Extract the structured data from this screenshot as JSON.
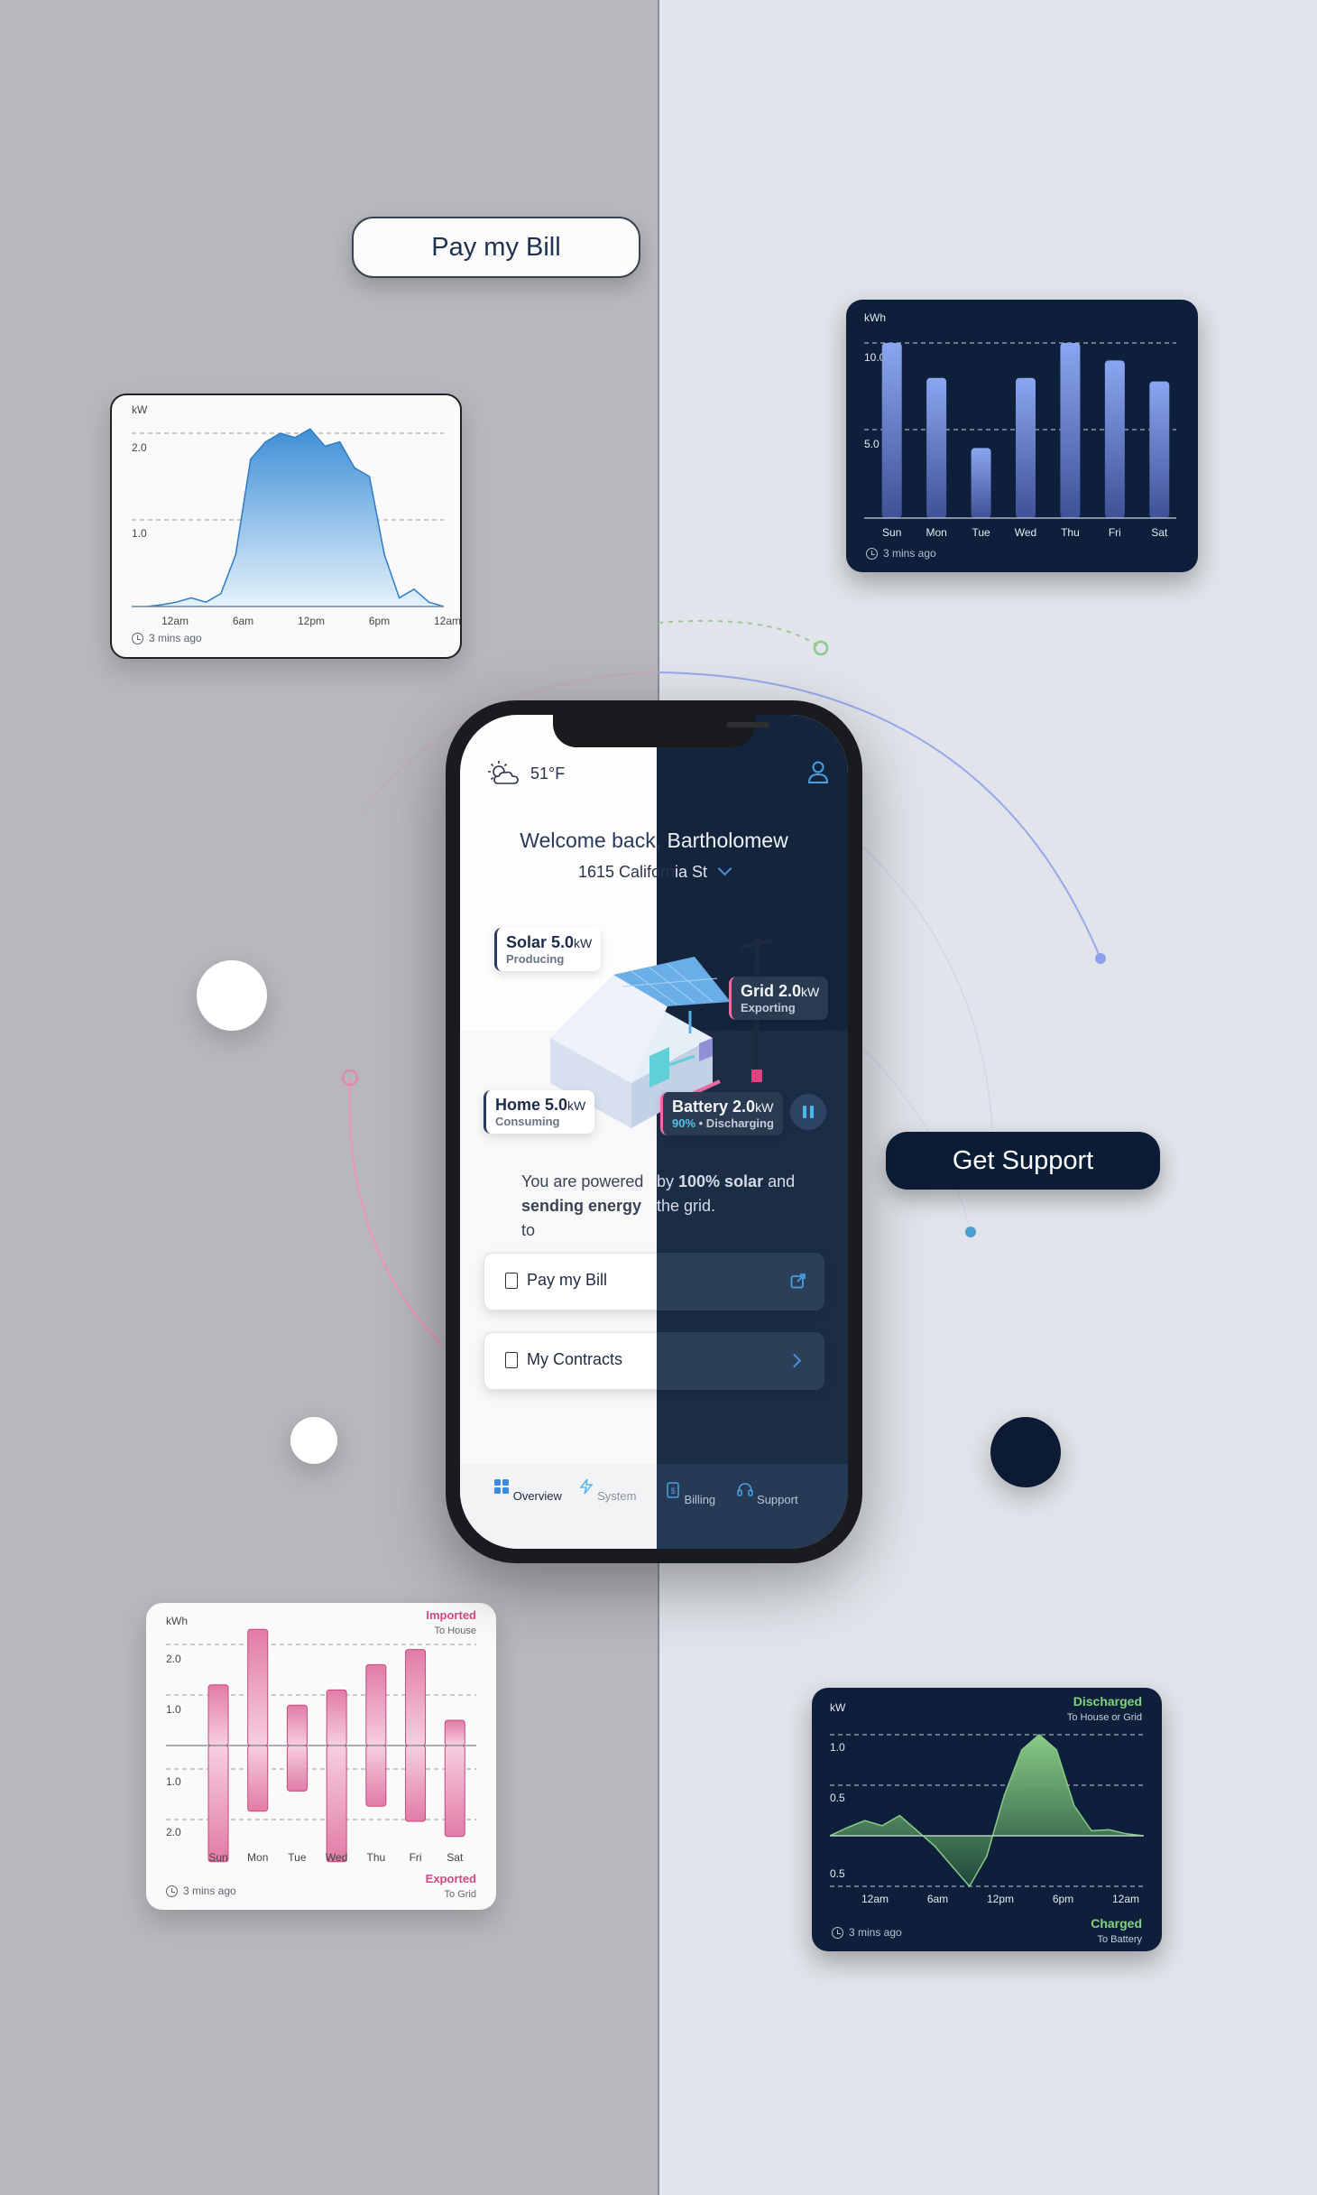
{
  "floating": {
    "pay_bill": "Pay my Bill",
    "get_support": "Get Support"
  },
  "colors": {
    "accent_blue": "#4a8fd8",
    "dark_navy": "#0d1f3a",
    "imported_pink": "#d24b86",
    "discharged_green": "#7ed07a"
  },
  "cards": {
    "solar_kw": {
      "unit": "kW",
      "yticks": [
        "2.0",
        "1.0"
      ],
      "xticks": [
        "12am",
        "6am",
        "12pm",
        "6pm",
        "12am"
      ],
      "updated": "3 mins ago"
    },
    "weekly_kwh": {
      "unit": "kWh",
      "yticks": [
        "10.0",
        "5.0"
      ],
      "categories": [
        "Sun",
        "Mon",
        "Tue",
        "Wed",
        "Thu",
        "Fri",
        "Sat"
      ],
      "updated": "3 mins ago"
    },
    "import_export": {
      "unit": "kWh",
      "top_label": "Imported",
      "top_sub": "To House",
      "bottom_label": "Exported",
      "bottom_sub": "To Grid",
      "yticks_top": [
        "2.0",
        "1.0"
      ],
      "yticks_bottom": [
        "1.0",
        "2.0"
      ],
      "categories": [
        "Sun",
        "Mon",
        "Tue",
        "Wed",
        "Thu",
        "Fri",
        "Sat"
      ],
      "updated": "3 mins ago"
    },
    "battery_kw": {
      "unit": "kW",
      "top_label": "Discharged",
      "top_sub": "To House or Grid",
      "bottom_label": "Charged",
      "bottom_sub": "To Battery",
      "yticks": [
        "1.0",
        "0.5",
        "0.5"
      ],
      "xticks": [
        "12am",
        "6am",
        "12pm",
        "6pm",
        "12am"
      ],
      "updated": "3 mins ago"
    }
  },
  "chart_data": [
    {
      "type": "area",
      "ylabel": "kW",
      "x": [
        "12am",
        "6am",
        "12pm",
        "6pm",
        "12am"
      ],
      "ylim": [
        0,
        2.0
      ],
      "series": [
        {
          "values": [
            0,
            0,
            0.02,
            0.05,
            0.1,
            0.05,
            0.15,
            0.6,
            1.7,
            1.9,
            2.0,
            1.95,
            2.05,
            1.85,
            1.9,
            1.6,
            1.5,
            0.6,
            0.1,
            0.2,
            0.05,
            0
          ]
        }
      ]
    },
    {
      "type": "bar",
      "ylabel": "kWh",
      "categories": [
        "Sun",
        "Mon",
        "Tue",
        "Wed",
        "Thu",
        "Fri",
        "Sat"
      ],
      "values": [
        10.0,
        8.0,
        4.0,
        8.0,
        10.0,
        9.0,
        7.8
      ],
      "ylim": [
        0,
        10.0
      ]
    },
    {
      "type": "bar",
      "ylabel": "kWh",
      "categories": [
        "Sun",
        "Mon",
        "Tue",
        "Wed",
        "Thu",
        "Fri",
        "Sat"
      ],
      "series": [
        {
          "name": "Imported",
          "values": [
            1.2,
            2.3,
            0.8,
            1.1,
            1.6,
            1.9,
            0.5
          ]
        },
        {
          "name": "Exported",
          "values": [
            2.3,
            1.3,
            0.9,
            2.3,
            1.2,
            1.5,
            1.8
          ]
        }
      ],
      "ylim": [
        -2.0,
        2.0
      ]
    },
    {
      "type": "area",
      "ylabel": "kW",
      "x": [
        "12am",
        "6am",
        "12pm",
        "6pm",
        "12am"
      ],
      "series": [
        {
          "values": [
            0,
            0.08,
            0.15,
            0.1,
            0.2,
            0.05,
            -0.1,
            -0.3,
            -0.5,
            -0.2,
            0.4,
            0.85,
            1.0,
            0.85,
            0.3,
            0.05,
            0.06,
            0.02,
            0
          ]
        }
      ]
    }
  ],
  "phone": {
    "temperature": "51°F",
    "welcome_left": "Welcome back,",
    "welcome_right": " Bartholomew",
    "address_left": "1615 Californ",
    "address_right": "ia St",
    "solar": {
      "title": "Solar 5.0",
      "unit": "kW",
      "status": "Producing"
    },
    "grid": {
      "title": "Grid 2.0",
      "unit": "kW",
      "status": "Exporting"
    },
    "home": {
      "title": "Home 5.0",
      "unit": "kW",
      "status": "Consuming"
    },
    "battery": {
      "title": "Battery 2.0",
      "unit": "kW",
      "percent": "90%",
      "status": " • Discharging"
    },
    "powered": {
      "l1": "You are powered ",
      "l1_bold": "100% solar",
      "r1_pre": "by ",
      "r1_post": " and",
      "l2_bold": "sending energy",
      "l2": " to",
      "r2": " the grid."
    },
    "actions": [
      {
        "label": "Pay my Bill"
      },
      {
        "label": "My Contracts"
      }
    ],
    "tabs": [
      "Overview",
      "System",
      "Billing",
      "Support"
    ]
  }
}
